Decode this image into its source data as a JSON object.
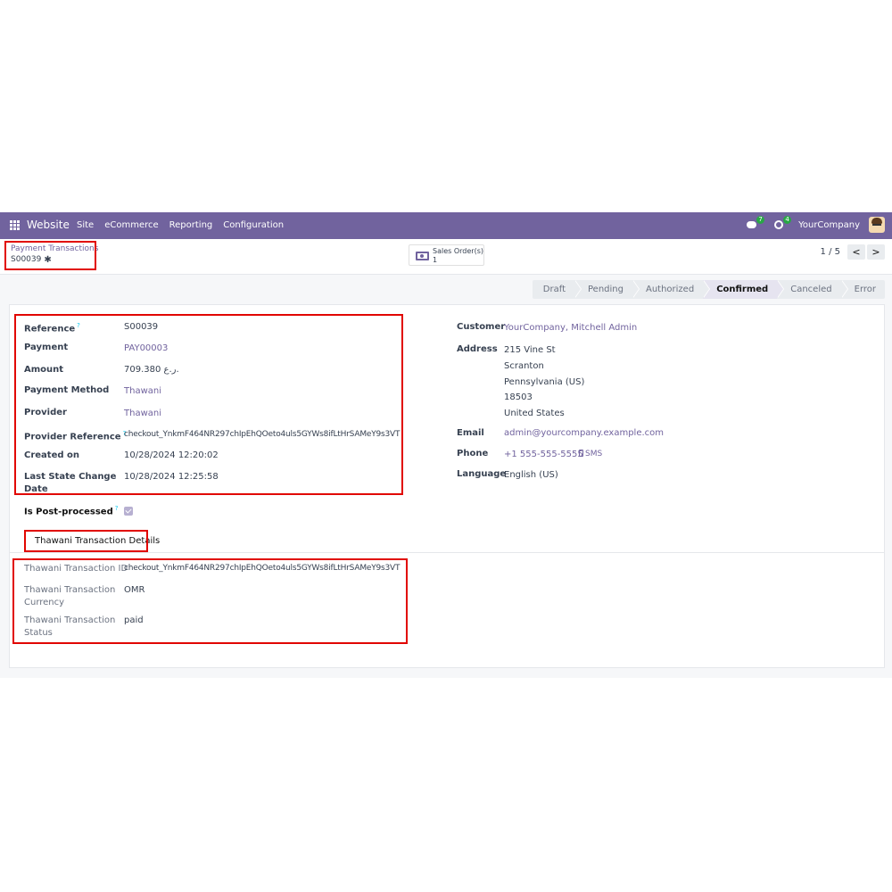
{
  "navbar": {
    "brand": "Website",
    "menu": [
      "Site",
      "eCommerce",
      "Reporting",
      "Configuration"
    ],
    "messages_count": "7",
    "activities_count": "4",
    "company": "YourCompany"
  },
  "breadcrumb": {
    "parent": "Payment Transactions",
    "current": "S00039"
  },
  "smart_button": {
    "label": "Sales Order(s)",
    "count": "1"
  },
  "pager": {
    "value": "1 / 5",
    "prev": "<",
    "next": ">"
  },
  "statusbar": {
    "stages": [
      "Draft",
      "Pending",
      "Authorized",
      "Confirmed",
      "Canceled",
      "Error"
    ],
    "active": "Confirmed"
  },
  "fields": {
    "reference": {
      "label": "Reference",
      "help": "?",
      "value": "S00039"
    },
    "payment": {
      "label": "Payment",
      "value": "PAY00003"
    },
    "amount": {
      "label": "Amount",
      "value": "709.380 ر.ع."
    },
    "payment_method": {
      "label": "Payment Method",
      "value": "Thawani"
    },
    "provider": {
      "label": "Provider",
      "value": "Thawani"
    },
    "provider_reference": {
      "label": "Provider Reference",
      "help": "?",
      "value": "checkout_YnkmF464NR297chIpEhQOeto4uls5GYWs8ifLtHrSAMeY9s3VT"
    },
    "created_on": {
      "label": "Created on",
      "value": "10/28/2024 12:20:02"
    },
    "last_state_change": {
      "label_line1": "Last State Change",
      "label_line2": "Date",
      "value": "10/28/2024 12:25:58"
    },
    "post_processed": {
      "label": "Is Post-processed",
      "help": "?",
      "checked": true
    }
  },
  "partner": {
    "customer": {
      "label": "Customer",
      "value": "YourCompany, Mitchell Admin"
    },
    "address": {
      "label": "Address",
      "lines": [
        "215 Vine St",
        "Scranton",
        "Pennsylvania (US)",
        "18503",
        "United States"
      ]
    },
    "email": {
      "label": "Email",
      "value": "admin@yourcompany.example.com"
    },
    "phone": {
      "label": "Phone",
      "value": "+1 555-555-5555",
      "sms": "SMS"
    },
    "language": {
      "label": "Language",
      "value": "English (US)"
    }
  },
  "thawani_tab": {
    "title": "Thawani Transaction Details",
    "transaction_id": {
      "label": "Thawani Transaction ID",
      "value": "checkout_YnkmF464NR297chIpEhQOeto4uls5GYWs8ifLtHrSAMeY9s3VT"
    },
    "currency": {
      "label_line1": "Thawani Transaction",
      "label_line2": "Currency",
      "value": "OMR"
    },
    "status": {
      "label_line1": "Thawani Transaction",
      "label_line2": "Status",
      "value": "paid"
    }
  },
  "colors": {
    "brand": "#71639e",
    "highlight": "#e10600",
    "help": "#0dcaf0"
  }
}
